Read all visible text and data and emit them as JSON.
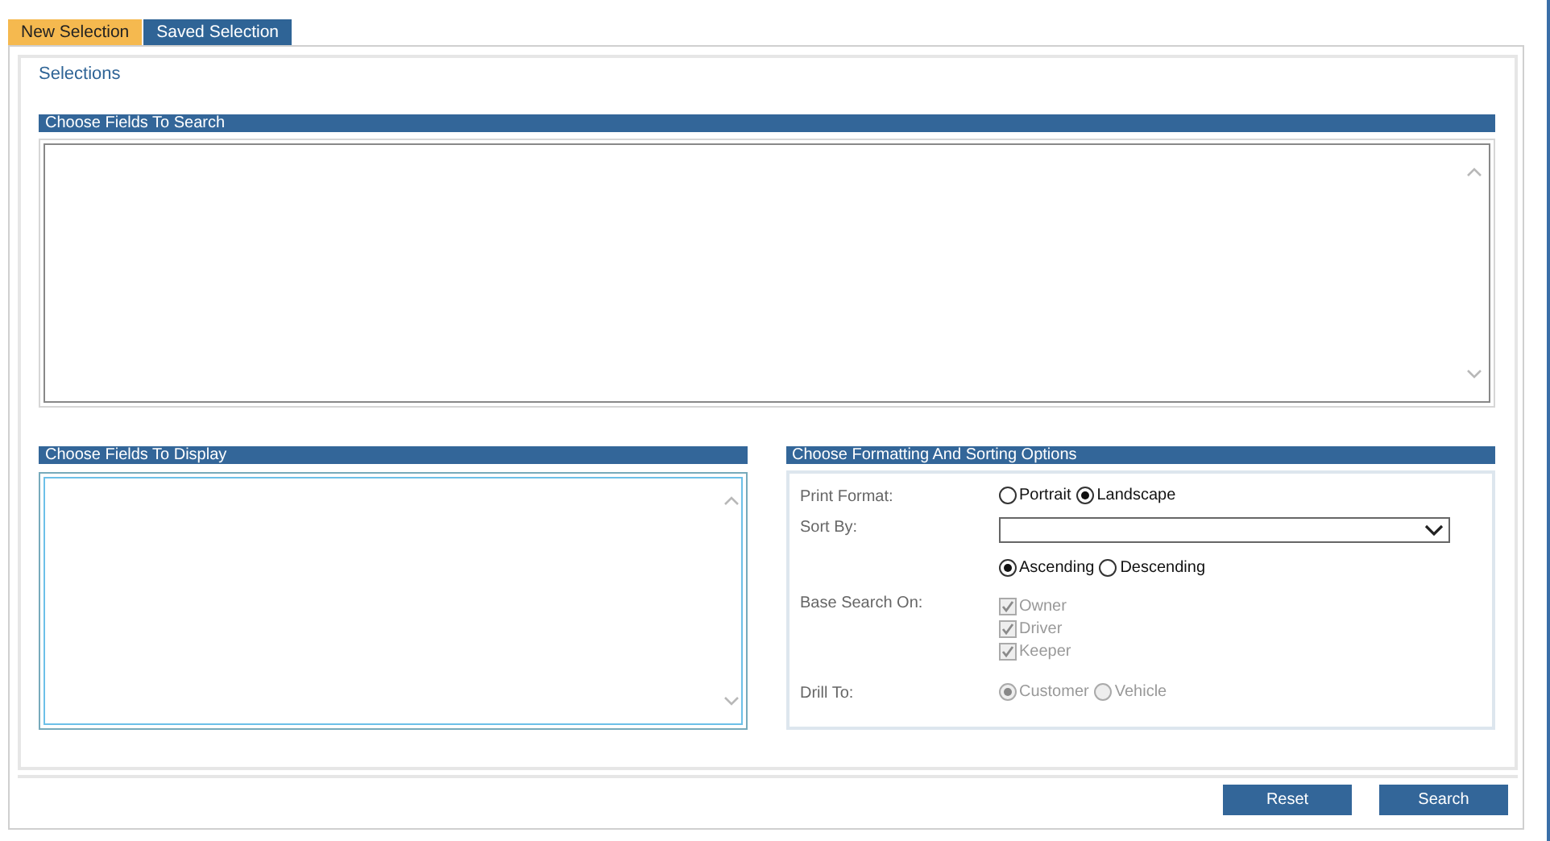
{
  "tabs": [
    {
      "label": "New Selection",
      "selected": true
    },
    {
      "label": "Saved Selection",
      "selected": false
    }
  ],
  "section_title": "Selections",
  "search_panel": {
    "title": "Choose Fields To Search"
  },
  "display_panel": {
    "title": "Choose Fields To Display"
  },
  "options_panel": {
    "title": "Choose Formatting And Sorting Options",
    "rows": [
      {
        "kind": "radio",
        "label": "Print Format:",
        "disabled": false,
        "options": [
          {
            "label": "Portrait",
            "selected": false
          },
          {
            "label": "Landscape",
            "selected": true
          }
        ]
      },
      {
        "kind": "select",
        "label": "Sort By:"
      },
      {
        "kind": "radio",
        "disabled": false,
        "options": [
          {
            "label": "Ascending",
            "selected": true
          },
          {
            "label": "Descending",
            "selected": false
          }
        ]
      },
      {
        "kind": "checks",
        "label": "Base Search On:",
        "disabled": true,
        "options": [
          {
            "label": "Owner",
            "checked": true
          },
          {
            "label": "Driver",
            "checked": true
          },
          {
            "label": "Keeper",
            "checked": true
          }
        ]
      },
      {
        "kind": "radio",
        "label": "Drill To:",
        "disabled": true,
        "options": [
          {
            "label": "Customer",
            "selected": true
          },
          {
            "label": "Vehicle",
            "selected": false
          }
        ]
      }
    ]
  },
  "buttons": [
    {
      "label": "Reset"
    },
    {
      "label": "Search"
    }
  ]
}
